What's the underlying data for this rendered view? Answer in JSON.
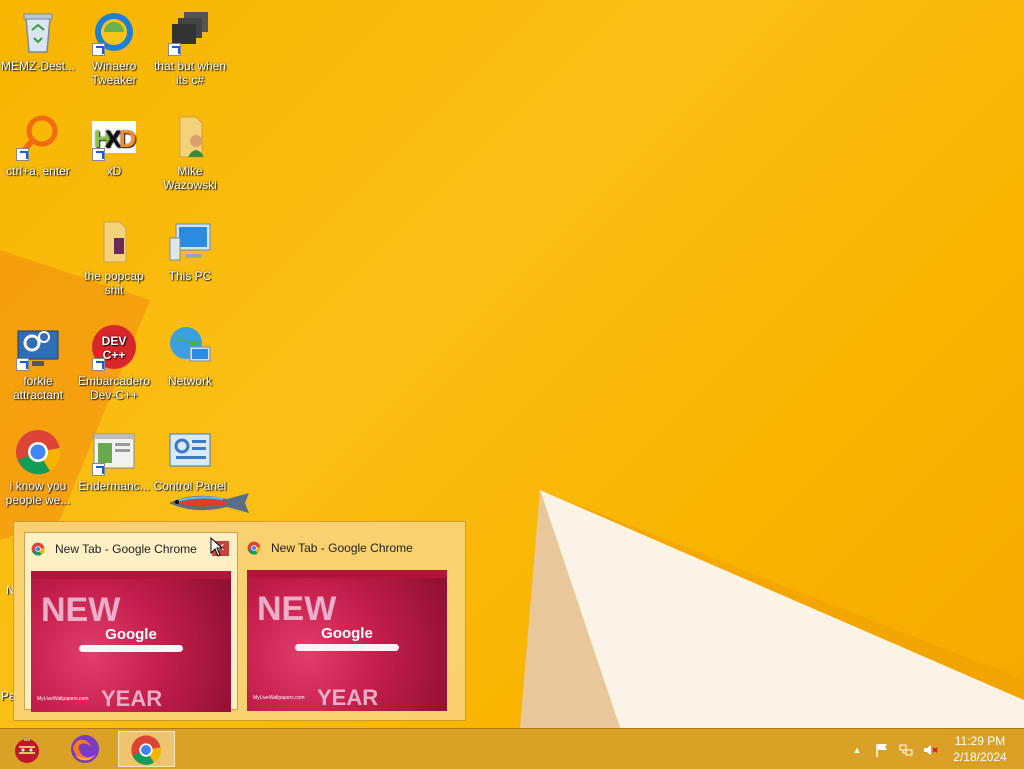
{
  "desktop": {
    "icons": [
      {
        "label": "MEMZ-Dest...",
        "icon": "recycle-bin-icon"
      },
      {
        "label": "Winaero Tweaker",
        "icon": "winaero-icon"
      },
      {
        "label": "that but when its c#",
        "icon": "windows-stack-icon"
      },
      {
        "label": "ctrl+a, enter",
        "icon": "magnifier-icon"
      },
      {
        "label": "xD",
        "icon": "hxd-icon"
      },
      {
        "label": "Mike Wazowski",
        "icon": "user-folder-icon"
      },
      {
        "label": "the popcap shit",
        "icon": "folder-icon"
      },
      {
        "label": "This PC",
        "icon": "computer-icon"
      },
      {
        "label": "forkie attractant",
        "icon": "settings-monitor-icon"
      },
      {
        "label": "Embarcadero Dev-C++",
        "icon": "devcpp-icon"
      },
      {
        "label": "Network",
        "icon": "network-globe-icon"
      },
      {
        "label": "i know you people we...",
        "icon": "chrome-icon"
      },
      {
        "label": "Endermanc...",
        "icon": "window-app-icon"
      },
      {
        "label": "Control Panel",
        "icon": "control-panel-icon"
      }
    ],
    "edge_left_1": "N",
    "edge_left_2": "Pa"
  },
  "thumbnails": [
    {
      "title": "New Tab - Google Chrome",
      "close": "✕",
      "preview_title": "Google",
      "preview_text": "NEW",
      "preview_year": "YEAR",
      "preview_footer": "MyLiveWallpapers.com"
    },
    {
      "title": "New Tab - Google Chrome",
      "preview_title": "Google",
      "preview_text": "NEW",
      "preview_year": "YEAR",
      "preview_footer": "MyLiveWallpapers.com"
    }
  ],
  "taskbar": {
    "buttons": [
      {
        "icon": "start-orb-icon"
      },
      {
        "icon": "firefox-icon"
      },
      {
        "icon": "chrome-icon",
        "active": true
      }
    ],
    "tray": {
      "chevron": "▲",
      "time": "11:29 PM",
      "date": "2/18/2024"
    }
  },
  "colors": {
    "wallpaper": "#f9b800",
    "taskbar": "#d6a028",
    "thumb_popup": "#fad278"
  }
}
